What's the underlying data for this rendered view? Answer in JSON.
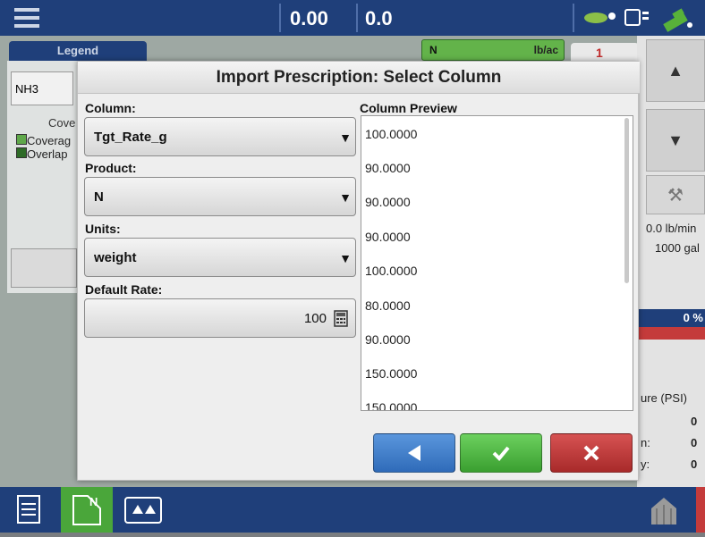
{
  "topbar": {
    "value1": "0.00",
    "value2": "0.0"
  },
  "background": {
    "legend_tab": "Legend",
    "product_tab": "N",
    "product_unit": "lb/ac",
    "alarm_count": "1",
    "side_button": "NH3",
    "coverage_label": "Cove",
    "legend_items": [
      "Coverag",
      "Overlap"
    ],
    "rate_readout": "0.0 lb/min",
    "volume_readout": "1000 gal",
    "percent_readout": "0 %",
    "pressure_label": "ure (PSI)",
    "pressure_value": "0",
    "row_label_a": "n:",
    "row_value_a": "0",
    "row_label_b": "y:",
    "row_value_b": "0"
  },
  "dialog": {
    "title": "Import Prescription: Select Column",
    "column_label": "Column:",
    "column_value": "Tgt_Rate_g",
    "product_label": "Product:",
    "product_value": "N",
    "units_label": "Units:",
    "units_value": "weight",
    "default_rate_label": "Default Rate:",
    "default_rate_value": "100",
    "preview_label": "Column Preview",
    "preview_values": [
      "100.0000",
      "90.0000",
      "90.0000",
      "90.0000",
      "100.0000",
      "80.0000",
      "90.0000",
      "150.0000",
      "150.0000"
    ]
  },
  "colors": {
    "back_button": "#3f7fcf",
    "accept_button": "#47b63b",
    "cancel_button": "#c43b3b",
    "topbar": "#1f3f7a"
  }
}
